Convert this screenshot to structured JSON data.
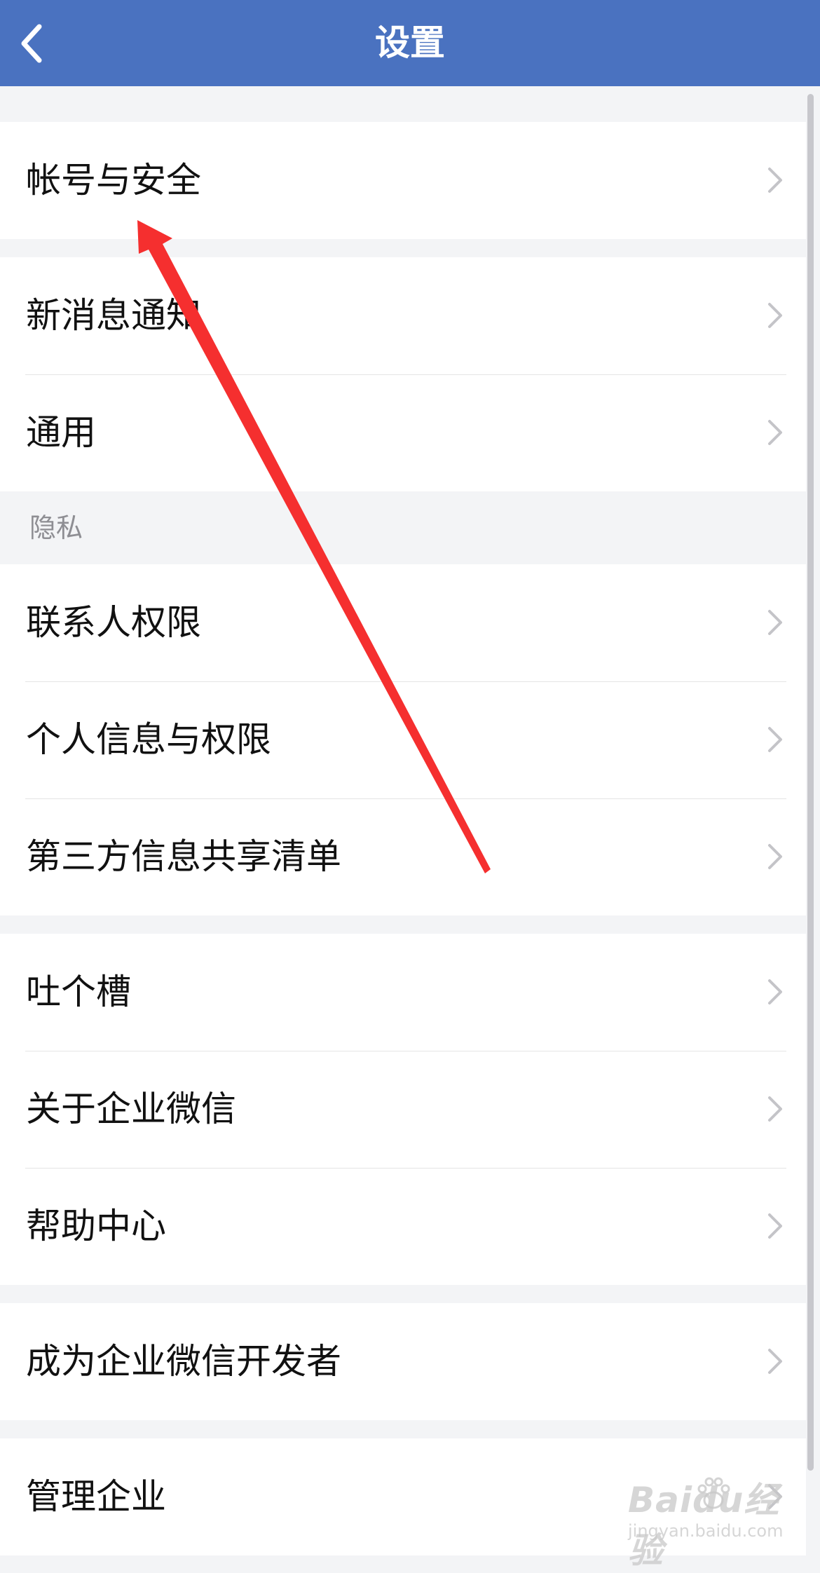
{
  "header": {
    "title": "设置"
  },
  "groups": [
    {
      "items": [
        "帐号与安全"
      ]
    },
    {
      "items": [
        "新消息通知",
        "通用"
      ]
    },
    {
      "header": "隐私",
      "items": [
        "联系人权限",
        "个人信息与权限",
        "第三方信息共享清单"
      ]
    },
    {
      "items": [
        "吐个槽",
        "关于企业微信",
        "帮助中心"
      ]
    },
    {
      "items": [
        "成为企业微信开发者"
      ]
    },
    {
      "items": [
        "管理企业"
      ]
    }
  ],
  "watermark": {
    "brand": "Baidu经验",
    "url": "jingyan.baidu.com"
  },
  "colors": {
    "header_bg": "#4a72c0",
    "annotation_arrow": "#f52f2f"
  }
}
